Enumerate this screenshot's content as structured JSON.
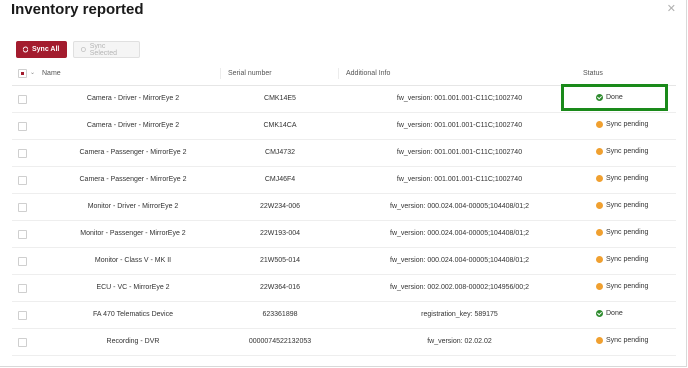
{
  "dialog": {
    "title": "Inventory reported",
    "close_icon": "close-icon"
  },
  "toolbar": {
    "sync_all_label": "Sync All",
    "sync_selected_label": "Sync Selected"
  },
  "table": {
    "headers": {
      "name": "Name",
      "serial": "Serial number",
      "info": "Additional Info",
      "status": "Status"
    },
    "rows": [
      {
        "name": "Camera - Driver - MirrorEye 2",
        "serial": "CMK14E5",
        "info": "fw_version: 001.001.001-C11C;1002740",
        "status": "Done",
        "state": "done"
      },
      {
        "name": "Camera - Driver - MirrorEye 2",
        "serial": "CMK14CA",
        "info": "fw_version: 001.001.001-C11C;1002740",
        "status": "Sync pending",
        "state": "pending"
      },
      {
        "name": "Camera - Passenger - MirrorEye 2",
        "serial": "CMJ4732",
        "info": "fw_version: 001.001.001-C11C;1002740",
        "status": "Sync pending",
        "state": "pending"
      },
      {
        "name": "Camera - Passenger - MirrorEye 2",
        "serial": "CMJ46F4",
        "info": "fw_version: 001.001.001-C11C;1002740",
        "status": "Sync pending",
        "state": "pending"
      },
      {
        "name": "Monitor - Driver - MirrorEye 2",
        "serial": "22W234-006",
        "info": "fw_version: 000.024.004-00005;104408/01;2",
        "status": "Sync pending",
        "state": "pending"
      },
      {
        "name": "Monitor - Passenger - MirrorEye 2",
        "serial": "22W193-004",
        "info": "fw_version: 000.024.004-00005;104408/01;2",
        "status": "Sync pending",
        "state": "pending"
      },
      {
        "name": "Monitor - Class V - MK II",
        "serial": "21W505-014",
        "info": "fw_version: 000.024.004-00005;104408/01;2",
        "status": "Sync pending",
        "state": "pending"
      },
      {
        "name": "ECU - VC - MirrorEye 2",
        "serial": "22W364-016",
        "info": "fw_version: 002.002.008-00002;104956/00;2",
        "status": "Sync pending",
        "state": "pending"
      },
      {
        "name": "FA 470 Telematics Device",
        "serial": "623361898",
        "info": "registration_key: 589175",
        "status": "Done",
        "state": "done"
      },
      {
        "name": "Recording - DVR",
        "serial": "000007452213205​3",
        "info": "fw_version: 02.02.02",
        "status": "Sync pending",
        "state": "pending"
      }
    ]
  },
  "colors": {
    "accent": "#a31c2e",
    "done": "#2e8b2e",
    "pending": "#f0a030",
    "highlight": "#1a8a1a"
  }
}
